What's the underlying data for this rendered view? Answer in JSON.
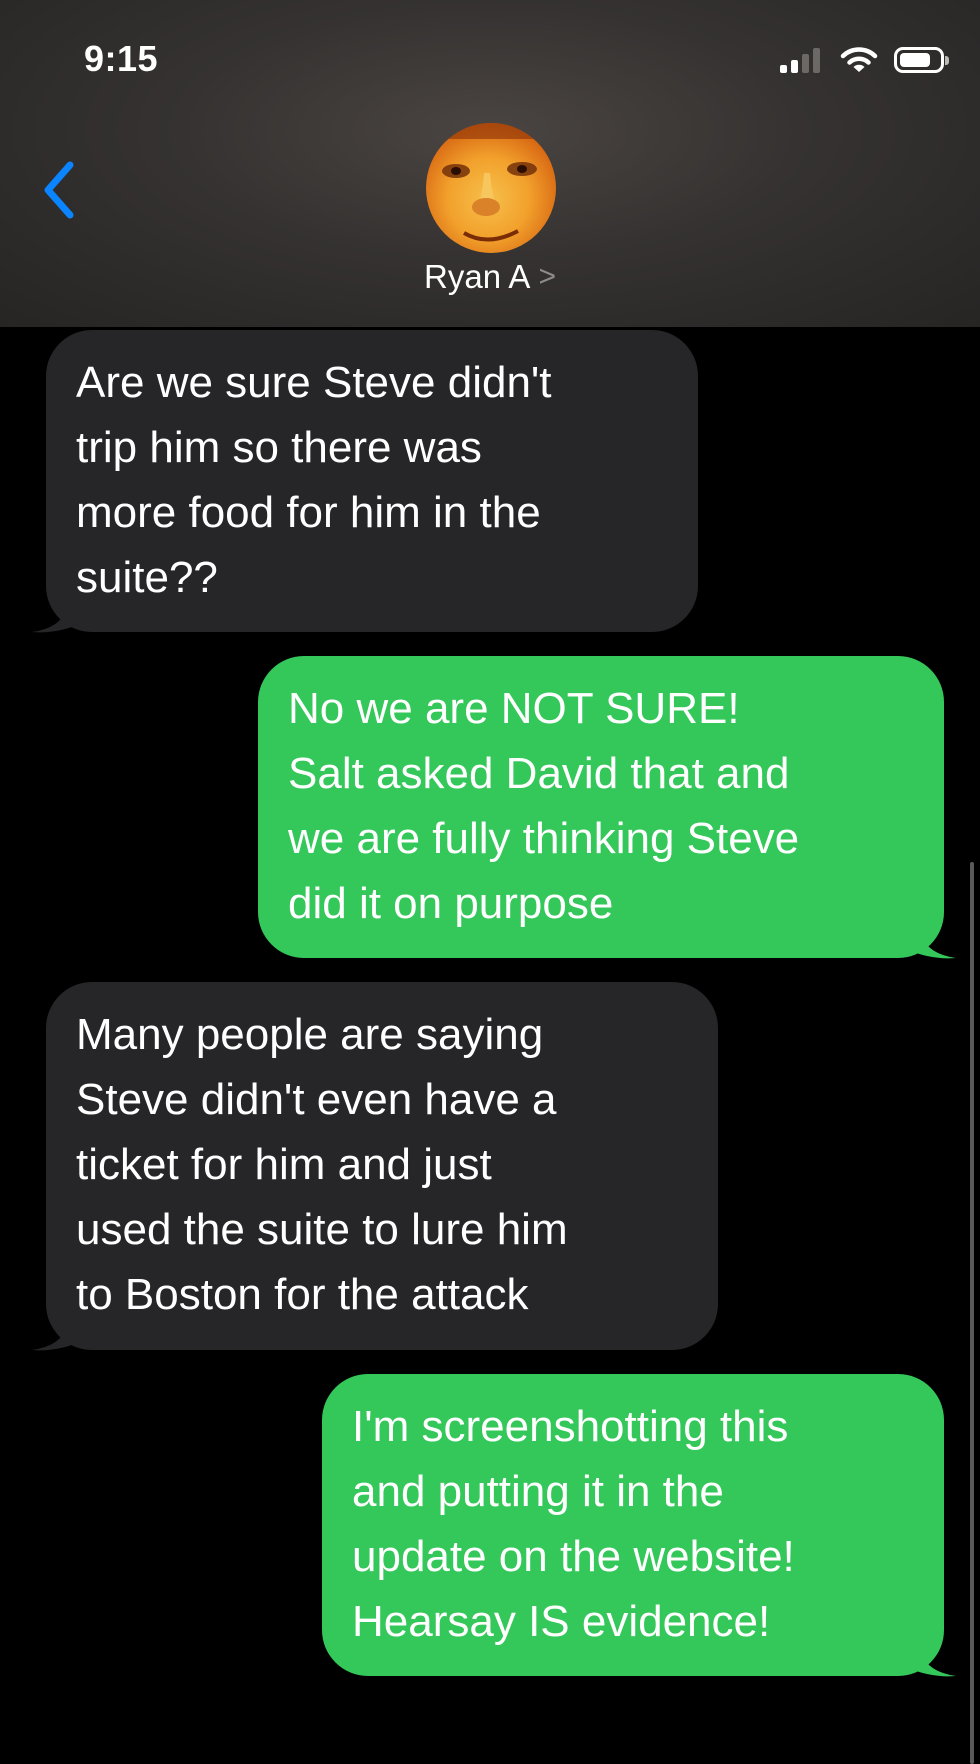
{
  "status_bar": {
    "time": "9:15",
    "signal_bars_filled": 2,
    "signal_bars_total": 4,
    "battery_level": 0.8
  },
  "header": {
    "contact_name": "Ryan A",
    "chevron": ">",
    "back_icon": "chevron-left-icon"
  },
  "colors": {
    "accent": "#0a84ff",
    "sent_bubble": "#34c759",
    "received_bubble": "#262628",
    "background": "#000000"
  },
  "messages": [
    {
      "direction": "received",
      "text": "Are we sure Steve didn't\ntrip him so there was\nmore food for him in the\nsuite??"
    },
    {
      "direction": "sent",
      "text": "No we are NOT SURE!\nSalt asked David that and\nwe are fully thinking Steve\ndid it on purpose"
    },
    {
      "direction": "received",
      "text": "Many people are saying\nSteve didn't even have a\nticket for him and just\nused the suite to lure him\nto Boston for the attack"
    },
    {
      "direction": "sent",
      "text": "I'm screenshotting this\nand putting it in the\nupdate on the website!\nHearsay IS evidence!"
    }
  ]
}
